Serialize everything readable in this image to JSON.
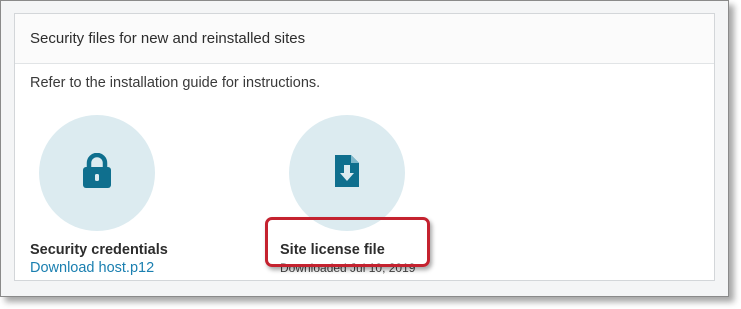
{
  "card": {
    "title": "Security files for new and reinstalled sites",
    "intro": "Refer to the installation guide for instructions."
  },
  "tiles": [
    {
      "icon": "lock-icon",
      "label": "Security credentials",
      "link": "Download host.p12"
    },
    {
      "icon": "file-download-icon",
      "label": "Site license file",
      "status": "Downloaded Jul 10, 2019"
    }
  ],
  "colors": {
    "accent": "#1a7fb0",
    "icon_fill": "#0f6f8e",
    "circle_bg": "#dcebf0",
    "highlight": "#c4222f"
  }
}
